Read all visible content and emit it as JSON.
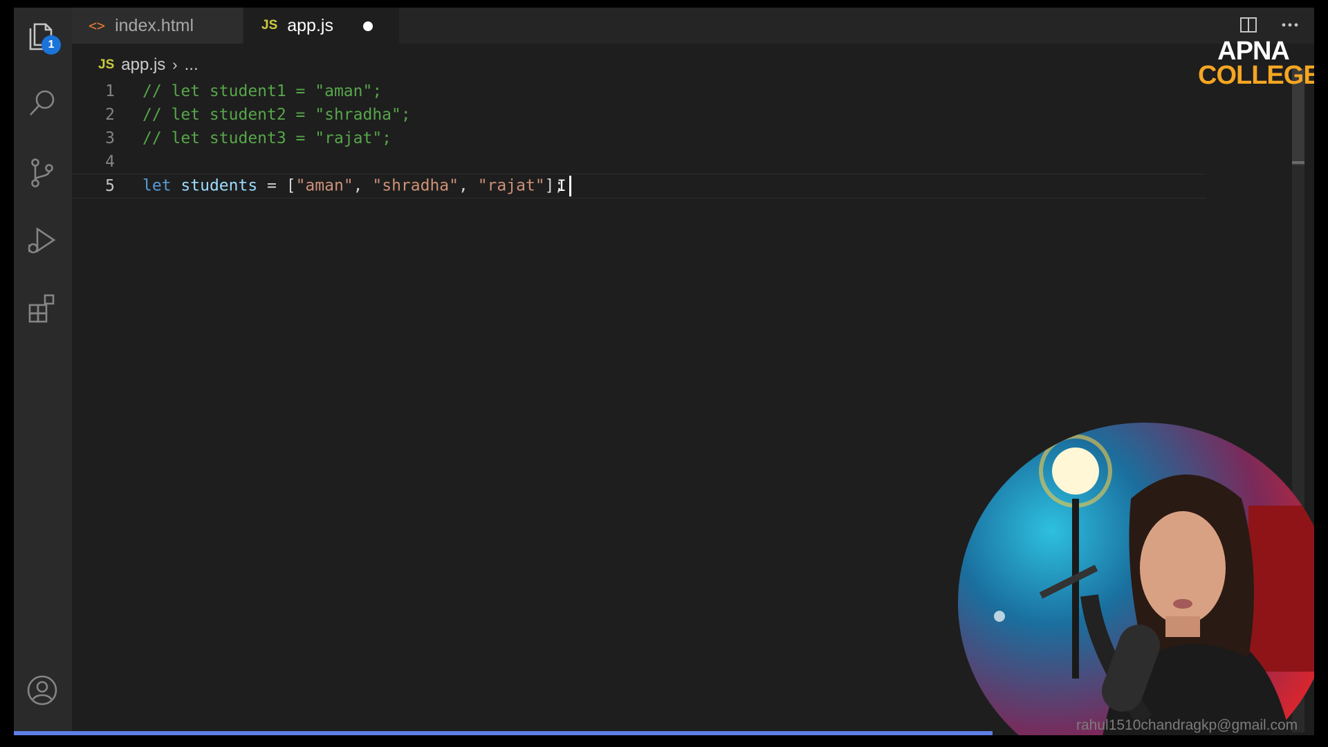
{
  "tabs": [
    {
      "label": "index.html",
      "icon": "html-icon",
      "active": false
    },
    {
      "label": "app.js",
      "icon": "js-icon",
      "active": true,
      "unsaved": true
    }
  ],
  "activity_bar": {
    "explorer_badge": "1",
    "icons": [
      "files-icon",
      "search-icon",
      "source-control-icon",
      "run-debug-icon",
      "extensions-icon",
      "account-icon"
    ]
  },
  "breadcrumb": {
    "file_icon_text": "JS",
    "file": "app.js",
    "rest": "..."
  },
  "tab_icon_text": {
    "html": "<>",
    "js": "JS"
  },
  "editor": {
    "lines": [
      {
        "num": "1",
        "comment": "// let student1 = \"aman\";"
      },
      {
        "num": "2",
        "comment": "// let student2 = \"shradha\";"
      },
      {
        "num": "3",
        "comment": "// let student3 = \"rajat\";"
      },
      {
        "num": "4"
      },
      {
        "num": "5",
        "kw": "let",
        "var": "students",
        "eq": " = [",
        "s1": "\"aman\"",
        "c1": ", ",
        "s2": "\"shradha\"",
        "c2": ", ",
        "s3": "\"rajat\"",
        "end": "];"
      }
    ]
  },
  "logo": {
    "line1": "APNA",
    "line2": "COLLEGE"
  },
  "watermark": "rahul1510chandragkp@gmail.com",
  "colors": {
    "comment": "#57a64a",
    "keyword": "#569cd6",
    "variable": "#9cdcfe",
    "string": "#ce9178",
    "logo_accent": "#f5a623",
    "badge": "#1a73d9"
  }
}
